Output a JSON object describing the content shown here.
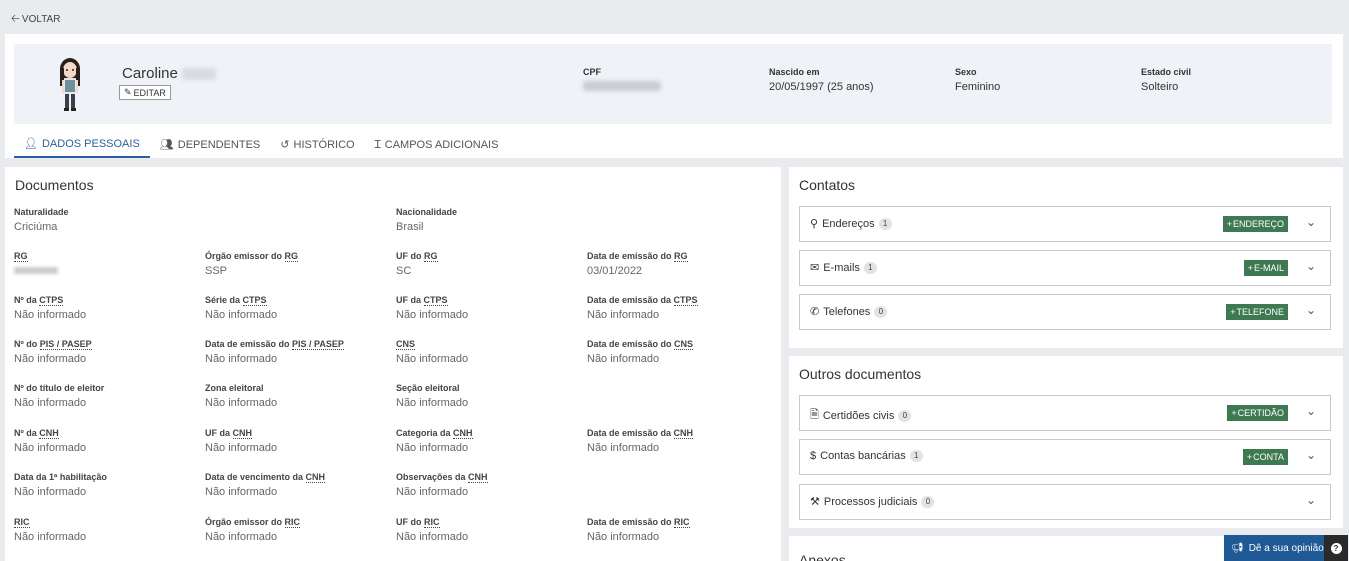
{
  "topbar": {
    "back_label": "VOLTAR",
    "back_icon": "arrow-left-icon"
  },
  "profile": {
    "first_name": "Caroline",
    "edit_label": "EDITAR",
    "cpf_label": "CPF",
    "birth_label": "Nascido em",
    "birth_value": "20/05/1997 (25 anos)",
    "sex_label": "Sexo",
    "sex_value": "Feminino",
    "civil_label": "Estado civil",
    "civil_value": "Solteiro"
  },
  "tabs": [
    {
      "label": "DADOS PESSOAIS",
      "icon": "user-icon",
      "active": true
    },
    {
      "label": "DEPENDENTES",
      "icon": "users-icon"
    },
    {
      "label": "HISTÓRICO",
      "icon": "history-icon"
    },
    {
      "label": "CAMPOS ADICIONAIS",
      "icon": "text-cursor-icon"
    }
  ],
  "documents": {
    "title": "Documentos",
    "naturalidade_label": "Naturalidade",
    "naturalidade_value": "Criciúma",
    "nacionalidade_label": "Nacionalidade",
    "nacionalidade_value": "Brasil",
    "rg_label": "RG",
    "rg_orgao_label_pre": "Órgão emissor do ",
    "rg_orgao_abbr": "RG",
    "rg_orgao_value": "SSP",
    "rg_uf_label_pre": "UF do ",
    "rg_uf_abbr": "RG",
    "rg_uf_value": "SC",
    "rg_data_label_pre": "Data de emissão do ",
    "rg_data_abbr": "RG",
    "rg_data_value": "03/01/2022",
    "ctps_num_pre": "Nº da ",
    "ctps_abbr": "CTPS",
    "ctps_serie_pre": "Série da ",
    "ctps_uf_pre": "UF da ",
    "ctps_data_pre": "Data de emissão da ",
    "pis_num_pre": "Nº do ",
    "pis_abbr": "PIS / PASEP",
    "pis_data_pre": "Data de emissão do ",
    "cns_abbr": "CNS",
    "cns_data_pre": "Data de emissão do ",
    "titulo_label": "Nº do título de eleitor",
    "zona_label": "Zona eleitoral",
    "secao_label": "Seção eleitoral",
    "cnh_num_pre": "Nº da ",
    "cnh_abbr": "CNH",
    "cnh_uf_pre": "UF da ",
    "cnh_cat_pre": "Categoria da ",
    "cnh_data_pre": "Data de emissão da ",
    "cnh_hab_label": "Data da 1ª habilitação",
    "cnh_venc_pre": "Data de vencimento da ",
    "cnh_obs_pre": "Observações da ",
    "ric_abbr": "RIC",
    "ric_orgao_pre": "Órgão emissor do ",
    "ric_uf_pre": "UF do ",
    "ric_data_pre": "Data de emissão do ",
    "not_informed": "Não informado"
  },
  "contacts": {
    "title": "Contatos",
    "items": [
      {
        "label": "Endereços",
        "count": "1",
        "button": "ENDEREÇO",
        "icon": "map-marker-icon"
      },
      {
        "label": "E-mails",
        "count": "1",
        "button": "E-MAIL",
        "icon": "envelope-icon"
      },
      {
        "label": "Telefones",
        "count": "0",
        "button": "TELEFONE",
        "icon": "phone-icon"
      }
    ]
  },
  "other_docs": {
    "title": "Outros documentos",
    "items": [
      {
        "label": "Certidões civis",
        "count": "0",
        "button": "CERTIDÃO",
        "icon": "document-icon"
      },
      {
        "label": "Contas bancárias",
        "count": "1",
        "button": "CONTA",
        "icon": "dollar-icon"
      },
      {
        "label": "Processos judiciais",
        "count": "0",
        "icon": "gavel-icon"
      }
    ]
  },
  "annex": {
    "title": "Anexos"
  },
  "feedback": {
    "label": "Dê a sua opinião",
    "help": "?"
  },
  "colors": {
    "accent": "#2b5fa8",
    "add_button": "#3d7a52",
    "feedback": "#1f5a96"
  }
}
